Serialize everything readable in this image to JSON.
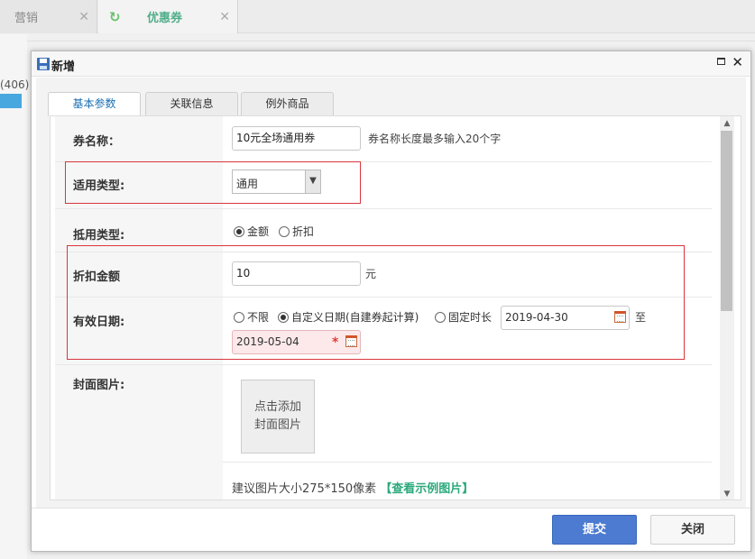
{
  "app_tabs": [
    {
      "label": "营销"
    },
    {
      "label": "优惠券"
    }
  ],
  "left_count": "(406)",
  "dialog": {
    "title": "新增",
    "tabs": [
      "基本参数",
      "关联信息",
      "例外商品"
    ],
    "fields": {
      "name": {
        "label": "券名称：",
        "value": "10元全场通用券",
        "hint": "券名称长度最多输入20个字"
      },
      "apply_type": {
        "label": "适用类型:",
        "value": "通用"
      },
      "deduct_type": {
        "label": "抵用类型:",
        "options": [
          "金额",
          "折扣"
        ],
        "selected": "金额"
      },
      "discount_amount": {
        "label": "折扣金额",
        "value": "10",
        "unit": "元"
      },
      "valid_date": {
        "label": "有效日期:",
        "options": [
          "不限",
          "自定义日期(自建券起计算)",
          "固定时长"
        ],
        "selected": "自定义日期(自建券起计算)",
        "start": "2019-04-30",
        "to": "至",
        "end": "2019-05-04"
      },
      "cover": {
        "label": "封面图片:",
        "upload_line1": "点击添加",
        "upload_line2": "封面图片",
        "hint": "建议图片大小275*150像素",
        "link": "【查看示例图片】"
      }
    },
    "buttons": {
      "submit": "提交",
      "close": "关闭"
    }
  },
  "colors": {
    "primary": "#4d7bd1",
    "highlight": "#d9363e",
    "tab_active": "#1a6fb3",
    "link": "#2ca97b"
  }
}
